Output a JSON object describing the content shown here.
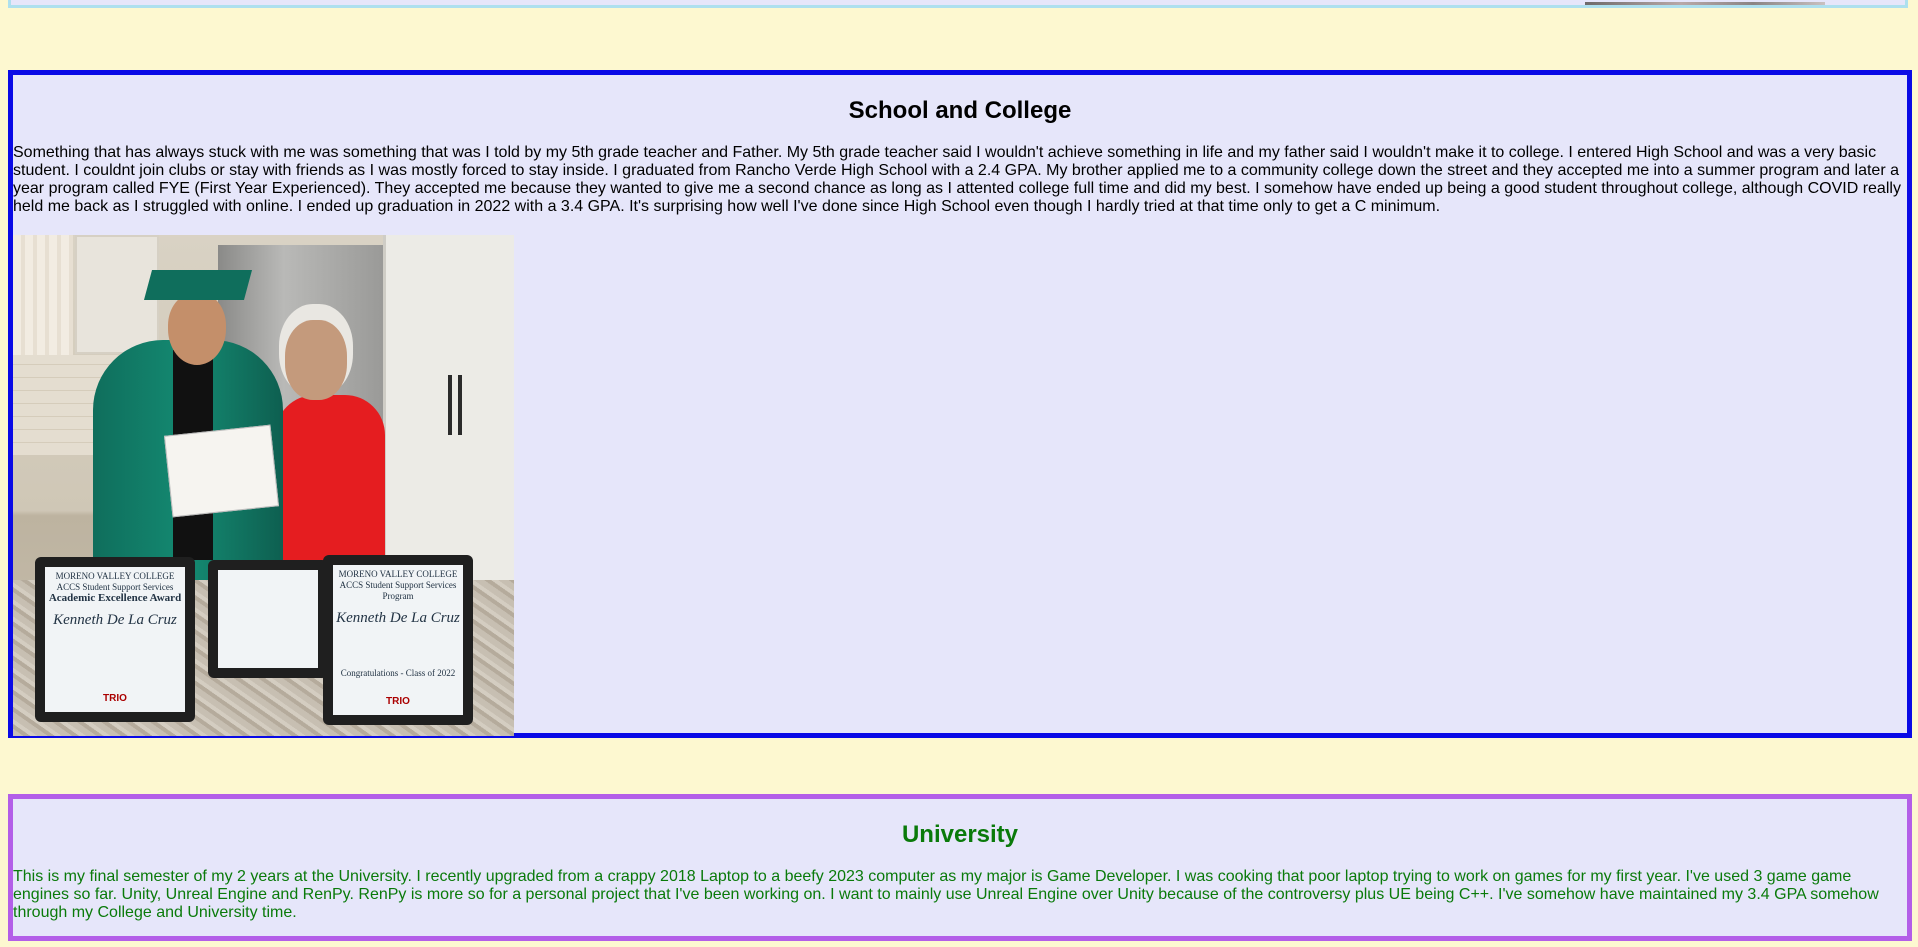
{
  "school": {
    "title": "School and College",
    "body": "Something that has always stuck with me was something that was I told by my 5th grade teacher and Father. My 5th grade teacher said I wouldn't achieve something in life and my father said I wouldn't make it to college. I entered High School and was a very basic student. I couldnt join clubs or stay with friends as I was mostly forced to stay inside. I graduated from Rancho Verde High School with a 2.4 GPA. My brother applied me to a community college down the street and they accepted me into a summer program and later a year program called FYE (First Year Experienced). They accepted me because they wanted to give me a second chance as long as I attented college full time and did my best. I somehow have ended up being a good student throughout college, although COVID really held me back as I struggled with online. I ended up graduation in 2022 with a 3.4 GPA. It's surprising how well I've done since High School even though I hardly tried at that time only to get a C minimum.",
    "photo": {
      "frame1_college": "MORENO VALLEY COLLEGE",
      "frame1_program": "ACCS Student Support Services",
      "frame1_award": "Academic Excellence Award",
      "frame1_name": "Kenneth De La Cruz",
      "frame1_logo": "TRIO",
      "frame3_college": "MORENO VALLEY COLLEGE",
      "frame3_program": "ACCS Student Support Services Program",
      "frame3_name": "Kenneth De La Cruz",
      "frame3_congrats": "Congratulations - Class of 2022",
      "frame3_logo": "TRIO"
    }
  },
  "university": {
    "title": "University",
    "body": "This is my final semester of my 2 years at the University. I recently upgraded from a crappy 2018 Laptop to a beefy 2023 computer as my major is Game Developer. I was cooking that poor laptop trying to work on games for my first year. I've used 3 game game engines so far. Unity, Unreal Engine and RenPy. RenPy is more so for a personal project that I've been working on. I want to mainly use Unreal Engine over Unity because of the controversy plus UE being C++. I've somehow have maintained my 3.4 GPA somehow through my College and University time."
  },
  "colors": {
    "page_background": "#fdf8d0",
    "section_background": "#e6e6fa",
    "school_border": "#0a0ae6",
    "university_border": "#b35ee8",
    "university_text": "#0a7a0a"
  }
}
